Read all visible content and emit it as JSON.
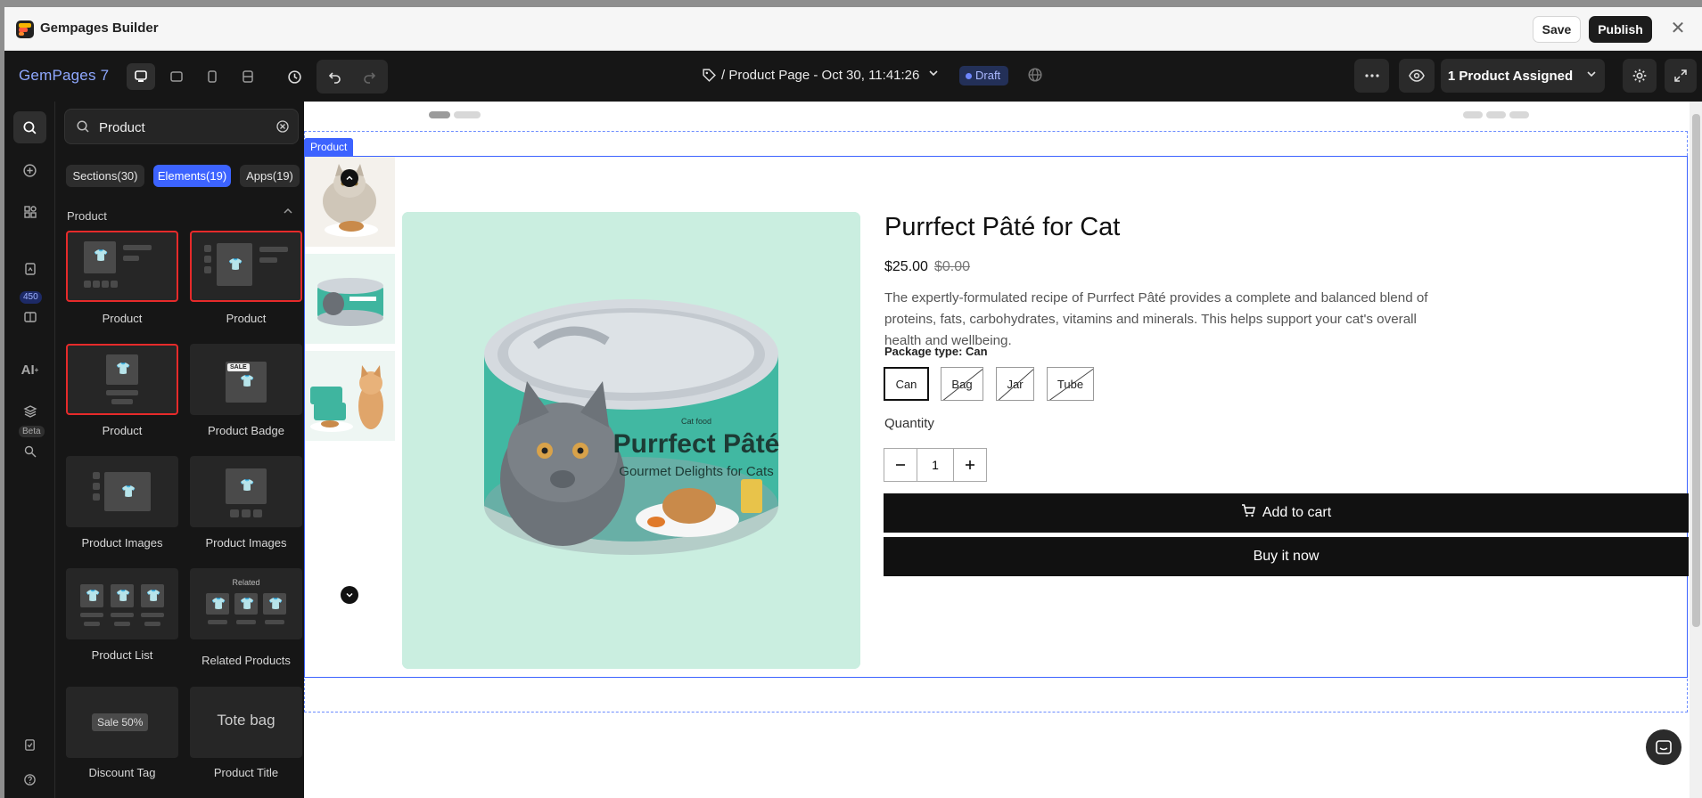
{
  "window": {
    "title": "Gempages Builder",
    "save_label": "Save",
    "publish_label": "Publish"
  },
  "toolbar": {
    "brand": "GemPages 7",
    "page_name": "/ Product Page - Oct 30, 11:41:26",
    "status": "Draft",
    "assigned": "1 Product Assigned"
  },
  "rail": {
    "badge_count": "450",
    "beta_label": "Beta",
    "ai_label": "AI"
  },
  "panel": {
    "search_value": "Product",
    "tabs": [
      {
        "label": "Sections(30)"
      },
      {
        "label": "Elements(19)"
      },
      {
        "label": "Apps(19)"
      }
    ],
    "group_title": "Product",
    "items": [
      {
        "label": "Product"
      },
      {
        "label": "Product"
      },
      {
        "label": "Product"
      },
      {
        "label": "Product Badge"
      },
      {
        "label": "Product Images"
      },
      {
        "label": "Product Images"
      },
      {
        "label": "Product List"
      },
      {
        "label": "Related Products"
      },
      {
        "label": "Discount Tag"
      },
      {
        "label": "Product Title"
      }
    ],
    "card_texts": {
      "sale_badge": "SALE",
      "related": "Related",
      "sale_50": "Sale 50%",
      "tote": "Tote bag"
    }
  },
  "canvas": {
    "tag": "Product",
    "product": {
      "title": "Purrfect Pâté for Cat",
      "price": "$25.00",
      "compare_price": "$0.00",
      "description": "The expertly-formulated recipe of Purrfect Pâté provides a complete and balanced blend of proteins, fats, carbohydrates, vitamins and minerals. This helps support your cat's overall health and wellbeing.",
      "package_label": "Package type: Can",
      "options": [
        {
          "label": "Can",
          "selected": true,
          "available": true
        },
        {
          "label": "Bag",
          "selected": false,
          "available": false
        },
        {
          "label": "Jar",
          "selected": false,
          "available": false
        },
        {
          "label": "Tube",
          "selected": false,
          "available": false
        }
      ],
      "quantity_label": "Quantity",
      "quantity": "1",
      "add_to_cart": "Add to cart",
      "buy_now": "Buy it now",
      "image_texts": {
        "brand_top": "Cat food",
        "brand": "Purrfect Pâté",
        "tagline": "Gourmet Delights for Cats"
      }
    }
  },
  "colors": {
    "accent": "#3c63ff",
    "selection": "#e62a2a",
    "image_bg": "#caeee0",
    "can_label": "#3fb59f"
  }
}
